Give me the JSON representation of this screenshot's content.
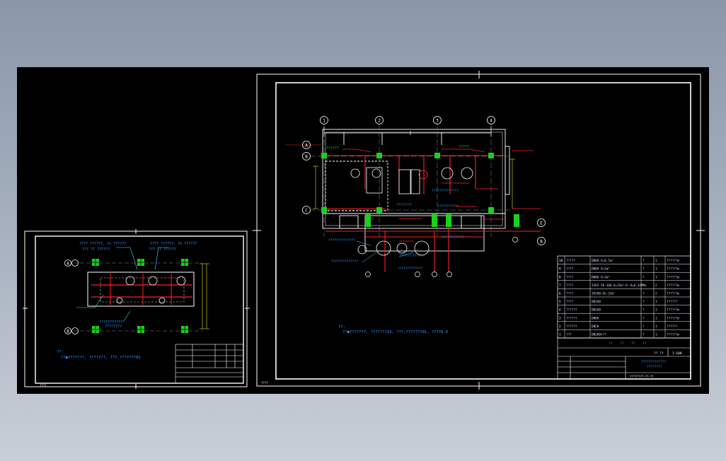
{
  "colors": {
    "background_gradient_top": "#8a97a9",
    "background_gradient_bottom": "#c9cfd8",
    "model_space": "#000000",
    "frame": "#ffffff",
    "grid_axis": "#ffffff",
    "pipe_red": "#ff2020",
    "equipment_green": "#19d219",
    "annotation_blue": "#3fa0ff",
    "leader_cyan": "#40e0ff",
    "dim_yellow": "#e6e600"
  },
  "left_sheet": {
    "axis_markers": [
      "A",
      "B"
    ],
    "notes": "??:\n  ??●???????, ???????, ???,???????01",
    "callout_top_left": "????  ??????, ?x ??????",
    "callout_top_left_2": "??? ?? ??????",
    "callout_top_right": "????  ??????, ?x ??????",
    "callout_top_right_2": "??? ?? ??????",
    "callout_mid": "???????????",
    "callout_mid_2": "????????",
    "sheet_label": "????"
  },
  "right_sheet": {
    "axis_top": [
      "1",
      "2",
      "3",
      "4"
    ],
    "axis_left": [
      "A",
      "B",
      "C"
    ],
    "axis_right": [
      "E",
      "B"
    ],
    "equipment_tag": "??????",
    "equipment_tag_2": "?????",
    "notes": "??:\n  ??●???????, ???????15, ???,???????01, ????0.0",
    "sheet_label": "????",
    "title_block": {
      "project": "?????????????",
      "drawing": "????????",
      "scale": "1:100",
      "sheet": "??  ??",
      "number": "????????-??-??"
    },
    "equipment_table": [
      {
        "no": "10",
        "name": "?????",
        "spec": "DN80   V=0.5m³",
        "unit": "?",
        "qty": "1",
        "note": "??????m"
      },
      {
        "no": "9",
        "name": "????",
        "spec": "DN80   V=2m³",
        "unit": "?",
        "qty": "1",
        "note": "??????m"
      },
      {
        "no": "8",
        "name": "????",
        "spec": "DN80   V=2m³",
        "unit": "?",
        "qty": "1",
        "note": "??????m"
      },
      {
        "no": "7",
        "name": "????",
        "spec": "IS65-50-160  Q=25m³/h H=0.32MPa",
        "unit": "?",
        "qty": "2",
        "note": "??????m"
      },
      {
        "no": "6",
        "name": "????",
        "spec": "IH100-65-250",
        "unit": "?",
        "qty": "2",
        "note": "??????m"
      },
      {
        "no": "5",
        "name": "????",
        "spec": "DN100",
        "unit": "?",
        "qty": "1",
        "note": "??????"
      },
      {
        "no": "4",
        "name": "??????",
        "spec": "DN100",
        "unit": "?",
        "qty": "1",
        "note": "??????m"
      },
      {
        "no": "3",
        "name": "??????",
        "spec": "DN80",
        "unit": "?",
        "qty": "1",
        "note": "??????m"
      },
      {
        "no": "2",
        "name": "??????",
        "spec": "DN50",
        "unit": "?",
        "qty": "1",
        "note": "??????"
      },
      {
        "no": "1",
        "name": "???",
        "spec": "DN200×??",
        "unit": "?",
        "qty": "1",
        "note": "??????m"
      }
    ],
    "table_header": [
      "??",
      "??",
      "??",
      "??"
    ]
  }
}
